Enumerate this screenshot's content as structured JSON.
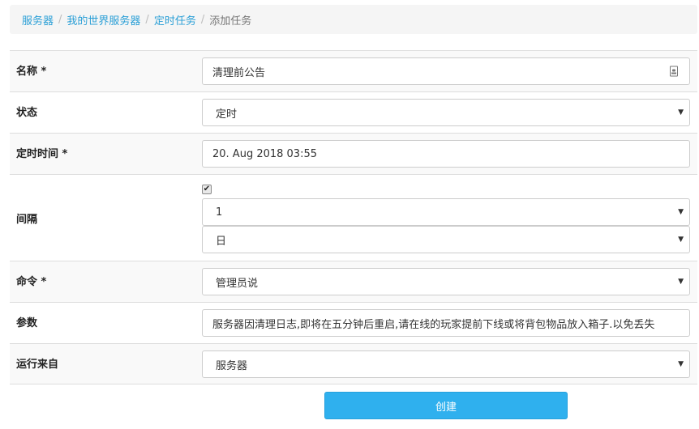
{
  "breadcrumb": {
    "items": [
      "服务器",
      "我的世界服务器",
      "定时任务"
    ],
    "current": "添加任务",
    "separator": "/"
  },
  "form": {
    "name": {
      "label": "名称 *",
      "value": "清理前公告",
      "icon": "contact-card-icon"
    },
    "status": {
      "label": "状态",
      "value": "定时"
    },
    "schedule_time": {
      "label": "定时时间 *",
      "value": "20. Aug 2018 03:55"
    },
    "interval": {
      "label": "间隔",
      "enabled": true,
      "check_mark": "✔",
      "amount": "1",
      "unit": "日"
    },
    "command": {
      "label": "命令 *",
      "value": "管理员说"
    },
    "params": {
      "label": "参数",
      "value": "服务器因清理日志,即将在五分钟后重启,请在线的玩家提前下线或将背包物品放入箱子.以免丢失"
    },
    "run_from": {
      "label": "运行来自",
      "value": "服务器"
    }
  },
  "submit_label": "创建",
  "caret_glyph": "▼",
  "colors": {
    "link": "#2a9fd6",
    "button": "#2fb0ee"
  }
}
